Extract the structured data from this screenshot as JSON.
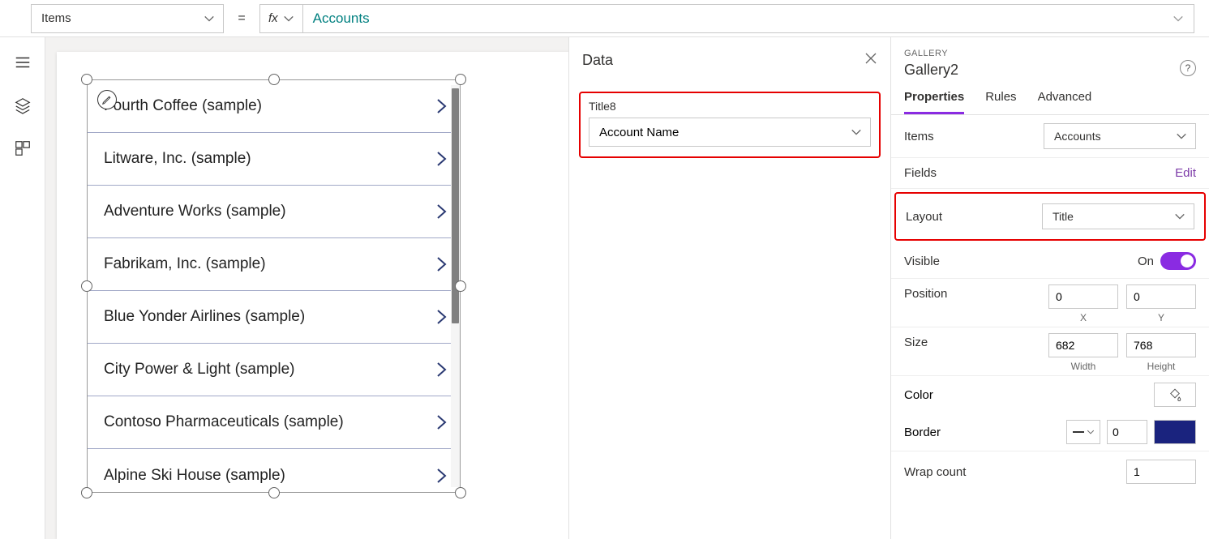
{
  "formula_bar": {
    "property": "Items",
    "value": "Accounts"
  },
  "gallery": {
    "items": [
      "Fourth Coffee (sample)",
      "Litware, Inc. (sample)",
      "Adventure Works (sample)",
      "Fabrikam, Inc. (sample)",
      "Blue Yonder Airlines (sample)",
      "City Power & Light (sample)",
      "Contoso Pharmaceuticals (sample)",
      "Alpine Ski House (sample)"
    ]
  },
  "data_panel": {
    "title": "Data",
    "field_label": "Title8",
    "field_value": "Account Name"
  },
  "props_panel": {
    "caption": "GALLERY",
    "name": "Gallery2",
    "tabs": {
      "properties": "Properties",
      "rules": "Rules",
      "advanced": "Advanced"
    },
    "items": {
      "label": "Items",
      "value": "Accounts"
    },
    "fields": {
      "label": "Fields",
      "link": "Edit"
    },
    "layout": {
      "label": "Layout",
      "value": "Title"
    },
    "visible": {
      "label": "Visible",
      "state": "On"
    },
    "position": {
      "label": "Position",
      "x": "0",
      "y": "0",
      "xlabel": "X",
      "ylabel": "Y"
    },
    "size": {
      "label": "Size",
      "w": "682",
      "h": "768",
      "wlabel": "Width",
      "hlabel": "Height"
    },
    "color": {
      "label": "Color"
    },
    "border": {
      "label": "Border",
      "width": "0",
      "color": "#1a237e"
    },
    "wrap": {
      "label": "Wrap count",
      "value": "1"
    }
  }
}
